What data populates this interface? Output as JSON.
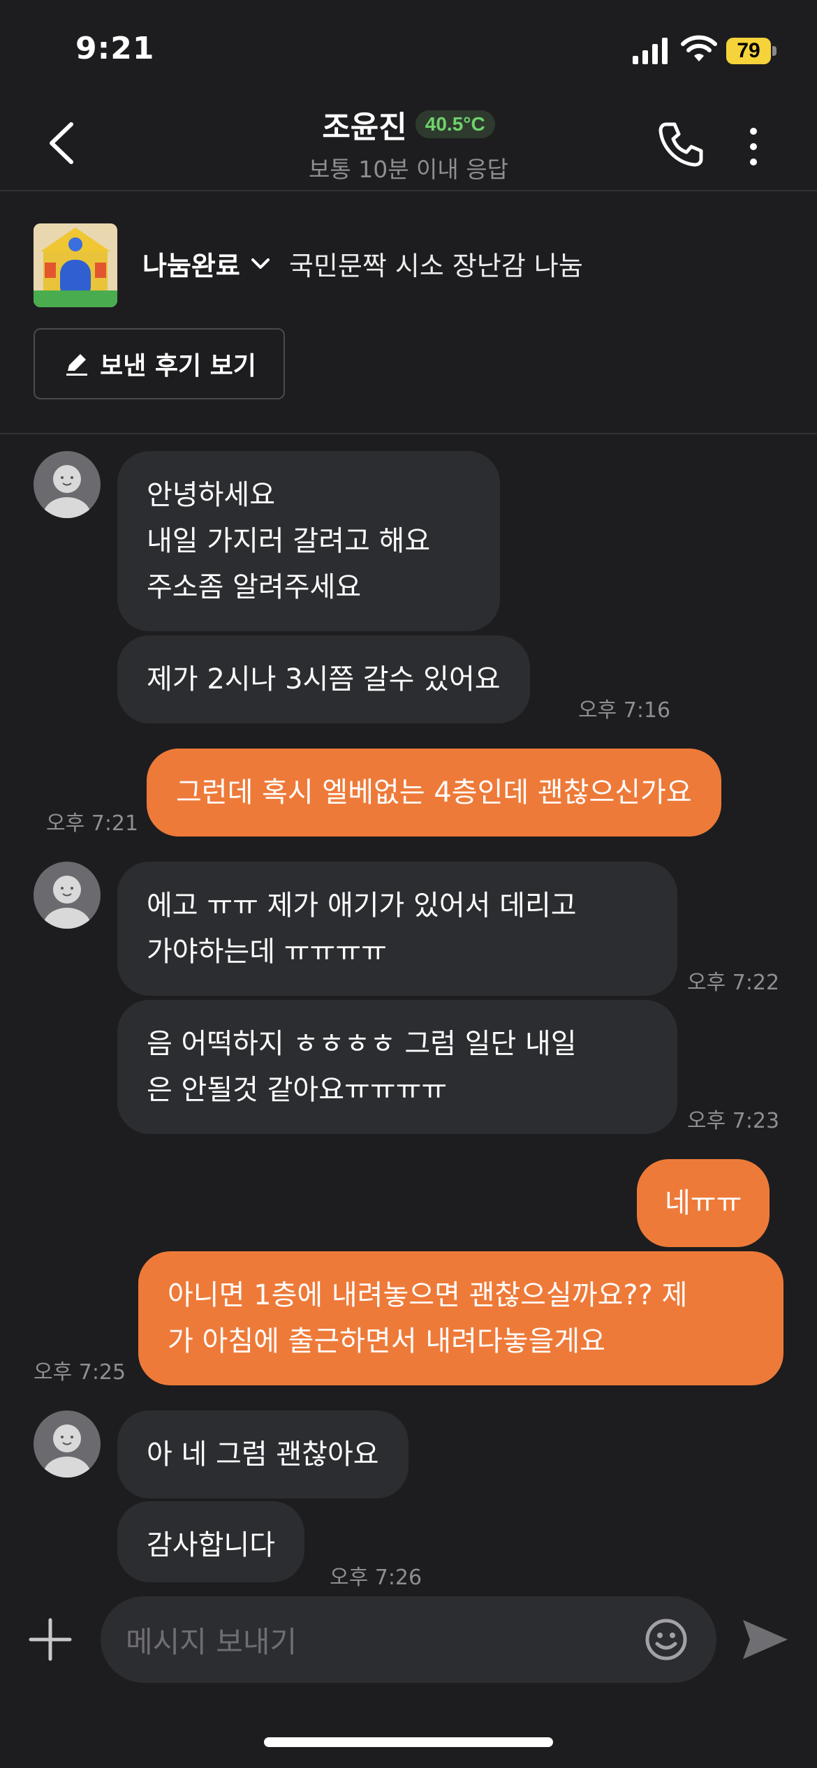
{
  "status_bar": {
    "time": "9:21",
    "battery": "79"
  },
  "header": {
    "name": "조윤진",
    "temperature": "40.5°C",
    "response_time": "보통 10분 이내 응답",
    "icons": [
      "back-chevron-icon",
      "phone-icon",
      "more-vertical-icon"
    ]
  },
  "product": {
    "status": "나눔완료",
    "title": "국민문짝 시소 장난감 나눔",
    "review_button": "보낸 후기 보기"
  },
  "messages": [
    {
      "from": "them",
      "lines": [
        "안녕하세요",
        "내일 가지러 갈려고 해요",
        "주소좀 알려주세요"
      ],
      "time": ""
    },
    {
      "from": "them",
      "lines": [
        "제가 2시나 3시쯤 갈수 있어요"
      ],
      "time": "오후 7:16"
    },
    {
      "from": "me",
      "lines": [
        "그런데 혹시 엘베없는 4층인데 괜찮으신가요"
      ],
      "time": "오후 7:21"
    },
    {
      "from": "them",
      "lines": [
        "에고 ㅠㅠ 제가 애기가 있어서 데리고",
        "가야하는데 ㅠㅠㅠㅠ"
      ],
      "time": "오후 7:22"
    },
    {
      "from": "them",
      "lines": [
        "음 어떡하지 ㅎㅎㅎㅎ  그럼 일단 내일",
        "은 안될것 같아요ㅠㅠㅠㅠ"
      ],
      "time": "오후 7:23"
    },
    {
      "from": "me",
      "lines": [
        "네ㅠㅠ"
      ],
      "time": ""
    },
    {
      "from": "me",
      "lines": [
        "아니면 1층에 내려놓으면 괜찮으실까요?? 제",
        "가 아침에 출근하면서 내려다놓을게요"
      ],
      "time": "오후 7:25"
    },
    {
      "from": "them",
      "lines": [
        "아 네 그럼 괜찮아요"
      ],
      "time": ""
    },
    {
      "from": "them",
      "lines": [
        "감사합니다"
      ],
      "time": "오후 7:26"
    }
  ],
  "composer": {
    "placeholder": "메시지 보내기"
  },
  "colors": {
    "outgoing": "#ee7a39",
    "incoming": "#2c2d31",
    "background": "#1d1d1f",
    "temperature": "#6fd26b"
  }
}
